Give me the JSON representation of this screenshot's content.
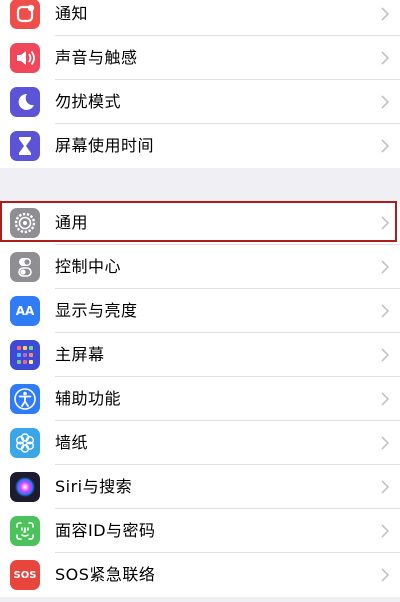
{
  "settings": {
    "group1": [
      {
        "label": "通知",
        "icon": "notifications-icon",
        "color": "#f04e4a"
      },
      {
        "label": "声音与触感",
        "icon": "sound-icon",
        "color": "#f0475a"
      },
      {
        "label": "勿扰模式",
        "icon": "moon-icon",
        "color": "#5b54d6"
      },
      {
        "label": "屏幕使用时间",
        "icon": "hourglass-icon",
        "color": "#5b54d6"
      }
    ],
    "group2": [
      {
        "label": "通用",
        "icon": "gear-icon",
        "color": "#8e8e93"
      },
      {
        "label": "控制中心",
        "icon": "toggles-icon",
        "color": "#8e8e93"
      },
      {
        "label": "显示与亮度",
        "icon": "display-icon",
        "color": "#2f7cf6",
        "icon_text": "AA"
      },
      {
        "label": "主屏幕",
        "icon": "home-screen-icon",
        "color": "#3b4bd8"
      },
      {
        "label": "辅助功能",
        "icon": "accessibility-icon",
        "color": "#2f7cf6"
      },
      {
        "label": "墙纸",
        "icon": "wallpaper-icon",
        "color": "#3aa6e8"
      },
      {
        "label": "Siri与搜索",
        "icon": "siri-icon",
        "color": "#1c1c2e"
      },
      {
        "label": "面容ID与密码",
        "icon": "face-id-icon",
        "color": "#4cc25c"
      },
      {
        "label": "SOS紧急联络",
        "icon": "sos-icon",
        "color": "#e8453c",
        "icon_text": "SOS"
      }
    ]
  },
  "highlighted_item": "通用",
  "highlight_color": "#b01c1c"
}
